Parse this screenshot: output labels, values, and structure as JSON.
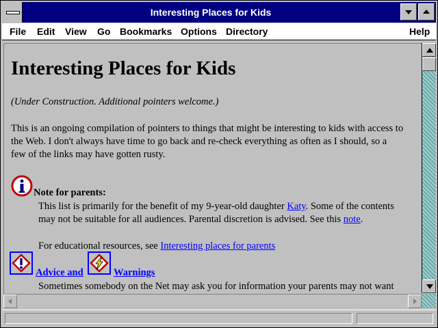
{
  "window": {
    "title": "Interesting Places for Kids"
  },
  "menu": {
    "file": "File",
    "edit": "Edit",
    "view": "View",
    "go": "Go",
    "bookmarks": "Bookmarks",
    "options": "Options",
    "directory": "Directory",
    "help": "Help"
  },
  "page": {
    "heading": "Interesting Places for Kids",
    "under_construction": "(Under Construction. Additional pointers welcome.)",
    "intro_line1": "This is an ongoing compilation of pointers to things that might be interesting to kids with access to",
    "intro_line2": "the Web. I don't always have time to go back and re-check everything as often as I should, so a",
    "intro_line3": "few of the links may have gotten rusty.",
    "note_label": "Note for parents:",
    "note_line1_a": "This list is primarily for the benefit of my 9-year-old daughter ",
    "note_link_katy": "Katy",
    "note_line1_b": ". Some of the contents",
    "note_line2_a": "may not be suitable for all audiences. Parental discretion is advised. See this ",
    "note_link_note": "note",
    "note_line2_b": ".",
    "edu_text": "For educational resources, see ",
    "edu_link": "Interesting places for parents",
    "advice_link": "Advice and",
    "warnings_link": "Warnings",
    "cut_line": "Sometimes somebody on the Net may ask you for information your parents may not want"
  },
  "icons": {
    "info": "info-icon",
    "warning": "exclamation-warning-icon",
    "lightning": "lightning-warning-icon"
  },
  "colors": {
    "titlebar": "#000080",
    "link": "#0000ff",
    "background": "#c0c0c0",
    "scroll_track": "#7fbfbf"
  }
}
